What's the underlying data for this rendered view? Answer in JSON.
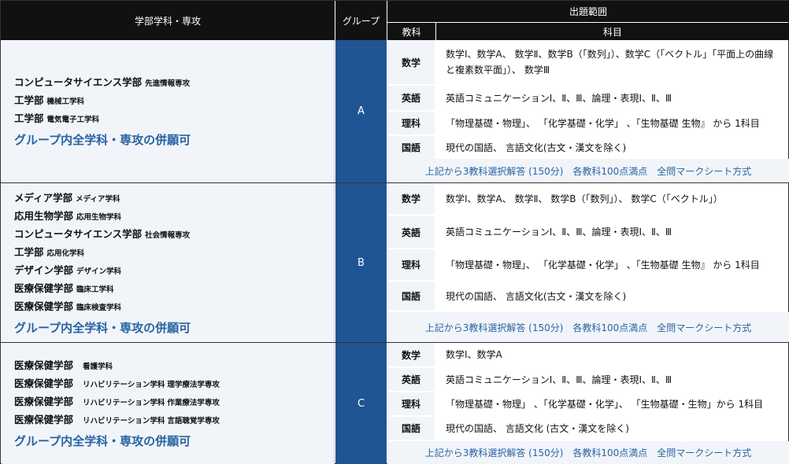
{
  "header": {
    "department_label": "学部学科・専攻",
    "group_label": "グループ",
    "scope_label": "出題範囲",
    "subject_label": "教科",
    "content_label": "科目"
  },
  "groups": [
    {
      "name": "A",
      "departments": [
        {
          "faculty": "コンピュータサイエンス学部",
          "department": "先進情報専攻"
        },
        {
          "faculty": "工学部",
          "department": "機械工学科"
        },
        {
          "faculty": "工学部",
          "department": "電気電子工学科"
        }
      ],
      "combo": "グループ内全学科・専攻の併願可",
      "subjects": [
        {
          "subject": "数学",
          "content": "数学Ⅰ、数学A、 数学Ⅱ、数学B（「数列」）、数学C（「ベクトル」「平面上の曲線と複素数平面」）、 数学Ⅲ"
        },
        {
          "subject": "英語",
          "content": "英語コミュニケーションⅠ、Ⅱ、Ⅲ、論理・表現Ⅰ、Ⅱ、Ⅲ"
        },
        {
          "subject": "理科",
          "content": "「物理基礎・物理」、 「化学基礎・化学」 、「生物基礎 生物』 から 1科目"
        },
        {
          "subject": "国語",
          "content": "現代の国語、 言語文化(古文・漢文を除く)"
        }
      ],
      "note": "上記から3教科選択解答 (150分)　各教科100点満点　全問マークシート方式"
    },
    {
      "name": "B",
      "departments": [
        {
          "faculty": "メディア学部",
          "department": "メディア学科"
        },
        {
          "faculty": "応用生物学部",
          "department": "応用生物学科"
        },
        {
          "faculty": "コンピュータサイエンス学部",
          "department": "社会情報専攻"
        },
        {
          "faculty": "工学部",
          "department": "応用化学科"
        },
        {
          "faculty": "デザイン学部",
          "department": "デザイン学科"
        },
        {
          "faculty": "医療保健学部",
          "department": "臨床工学科"
        },
        {
          "faculty": "医療保健学部",
          "department": "臨床検査学科"
        }
      ],
      "combo": "グループ内全学科・専攻の併願可",
      "subjects": [
        {
          "subject": "数学",
          "content": "数学Ⅰ、数学A、 数学Ⅱ、 数学B（「数列」）、 数学C（「ベクトル」）"
        },
        {
          "subject": "英語",
          "content": "英語コミュニケーションⅠ、Ⅱ、Ⅲ、論理・表現Ⅰ、Ⅱ、Ⅲ"
        },
        {
          "subject": "理科",
          "content": "「物理基礎・物理」、 「化学基礎・化学」 、「生物基礎 生物』 から 1科目"
        },
        {
          "subject": "国語",
          "content": "現代の国語、 言語文化(古文・漢文を除く)"
        }
      ],
      "note": "上記から3教科選択解答 (150分)　各教科100点満点　全問マークシート方式"
    },
    {
      "name": "C",
      "departments": [
        {
          "faculty": "医療保健学部",
          "department": "看護学科",
          "major": ""
        },
        {
          "faculty": "医療保健学部",
          "department": "リハビリテーション学科",
          "major": "理学療法学専攻"
        },
        {
          "faculty": "医療保健学部",
          "department": "リハビリテーション学科",
          "major": "作業療法学専攻"
        },
        {
          "faculty": "医療保健学部",
          "department": "リハビリテーション学科",
          "major": "言語聴覚学専攻"
        }
      ],
      "combo": "グループ内全学科・専攻の併願可",
      "subjects": [
        {
          "subject": "数学",
          "content": "数学Ⅰ、数学A"
        },
        {
          "subject": "英語",
          "content": "英語コミュニケーションⅠ、Ⅱ、Ⅲ、論理・表現Ⅰ、Ⅱ、Ⅲ"
        },
        {
          "subject": "理科",
          "content": "「物理基礎・物理」 、「化学基礎・化学」、 「生物基礎・生物」から 1科目"
        },
        {
          "subject": "国語",
          "content": "現代の国語、 言語文化 (古文・漢文を除く)"
        }
      ],
      "note": "上記から3教科選択解答 (150分)　各教科100点満点　全問マークシート方式"
    }
  ]
}
